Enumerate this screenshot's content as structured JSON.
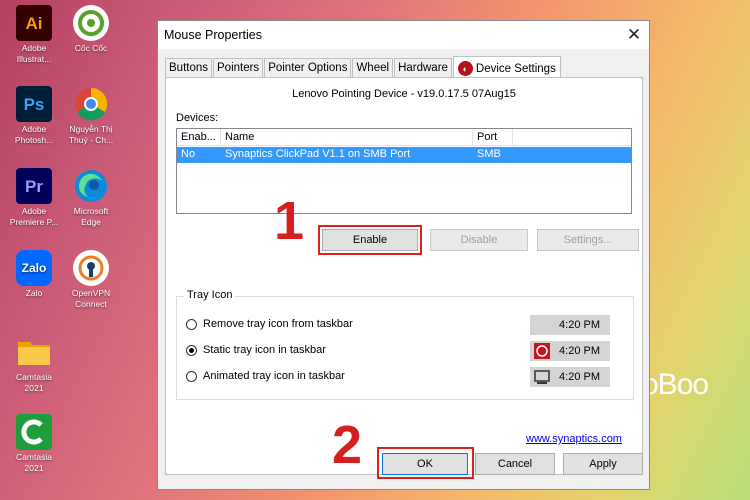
{
  "desktop": {
    "icons": [
      {
        "glyph": "Ai",
        "label": "Adobe Illustrat...",
        "bg": "#330000",
        "fg": "#ff9a00"
      },
      {
        "glyph": "",
        "label": "Cốc Cốc",
        "bg": "#ffffff",
        "fg": "#5aa02c"
      },
      {
        "glyph": "Ps",
        "label": "Adobe Photosh...",
        "bg": "#001e36",
        "fg": "#31a8ff"
      },
      {
        "glyph": "",
        "label": "Nguyễn Thị Thuý - Ch...",
        "bg": "#ffffff",
        "fg": "#db4437"
      },
      {
        "glyph": "Pr",
        "label": "Adobe Premiere P...",
        "bg": "#00005b",
        "fg": "#9999ff"
      },
      {
        "glyph": "",
        "label": "Microsoft Edge",
        "bg": "#ffffff",
        "fg": "#0c8ad8"
      },
      {
        "glyph": "Zalo",
        "label": "Zalo",
        "bg": "#0068ff",
        "fg": "#ffffff"
      },
      {
        "glyph": "",
        "label": "OpenVPN Connect",
        "bg": "#ffffff",
        "fg": "#ea7e20"
      },
      {
        "glyph": "",
        "label": "Camtasia 2021",
        "bg": "#f0c030",
        "fg": "#c08000"
      },
      {
        "glyph": "",
        "label": "Camtasia 2021",
        "bg": "#1f9d3a",
        "fg": "#ffffff"
      }
    ],
    "background_text": "voBoo"
  },
  "dialog": {
    "title": "Mouse Properties",
    "close": "✕",
    "tabs": [
      "Buttons",
      "Pointers",
      "Pointer Options",
      "Wheel",
      "Hardware",
      "Device Settings"
    ],
    "active_tab": "Device Settings",
    "device_header": "Lenovo Pointing Device - v19.0.17.5 07Aug15",
    "devices_label": "Devices:",
    "columns": [
      "Enab...",
      "Name",
      "Port"
    ],
    "rows": [
      {
        "enabled": "No",
        "name": "Synaptics ClickPad V1.1 on SMB Port",
        "port": "SMB"
      }
    ],
    "enable_button": "Enable",
    "disable_button": "Disable",
    "settings_button": "Settings...",
    "tray_group": "Tray Icon",
    "tray_options": [
      {
        "label": "Remove tray icon from taskbar",
        "selected": false,
        "time": "4:20 PM"
      },
      {
        "label": "Static tray icon in taskbar",
        "selected": true,
        "time": "4:20 PM"
      },
      {
        "label": "Animated tray icon in taskbar",
        "selected": false,
        "time": "4:20 PM"
      }
    ],
    "link": "www.synaptics.com",
    "ok": "OK",
    "cancel": "Cancel",
    "apply": "Apply"
  },
  "annotations": {
    "step1": "1",
    "step2": "2",
    "color": "#e02020"
  }
}
